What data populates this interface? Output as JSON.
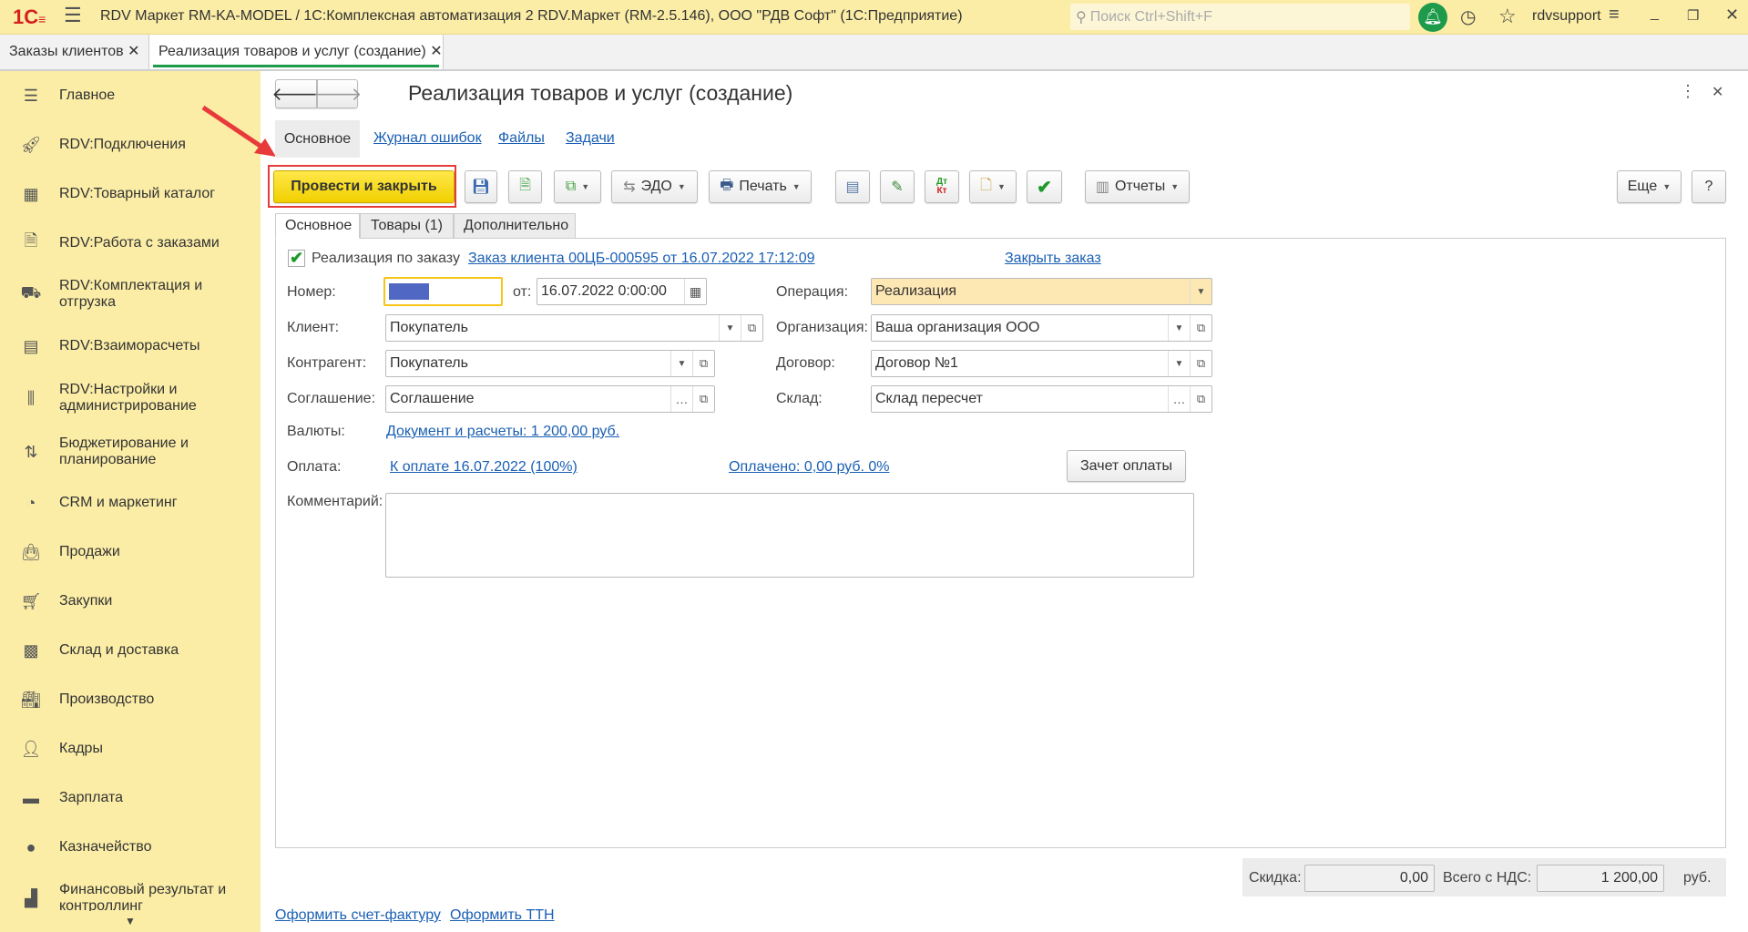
{
  "window": {
    "title": "RDV Маркет RM-KA-MODEL / 1С:Комплексная автоматизация 2 RDV.Маркет (RM-2.5.146), ООО \"РДВ Софт\"  (1С:Предприятие)",
    "search_placeholder": "Поиск Ctrl+Shift+F",
    "user": "rdvsupport",
    "logo": "1С"
  },
  "open_tabs": [
    {
      "label": "Заказы клиентов"
    },
    {
      "label": "Реализация товаров и услуг (создание)"
    }
  ],
  "sidebar": {
    "items": [
      {
        "label": "Главное",
        "icon": "menu-icon"
      },
      {
        "label": "RDV:Подключения",
        "icon": "rocket-icon"
      },
      {
        "label": "RDV:Товарный каталог",
        "icon": "grid-icon"
      },
      {
        "label": "RDV:Работа с заказами",
        "icon": "document-icon"
      },
      {
        "label": "RDV:Комплектация и отгрузка",
        "icon": "cart-loader-icon"
      },
      {
        "label": "RDV:Взаиморасчеты",
        "icon": "calculator-icon"
      },
      {
        "label": "RDV:Настройки и администрирование",
        "icon": "sliders-icon"
      },
      {
        "label": "Бюджетирование и планирование",
        "icon": "budget-icon"
      },
      {
        "label": "CRM и маркетинг",
        "icon": "pie-chart-icon"
      },
      {
        "label": "Продажи",
        "icon": "bag-icon"
      },
      {
        "label": "Закупки",
        "icon": "cart-icon"
      },
      {
        "label": "Склад и доставка",
        "icon": "warehouse-icon"
      },
      {
        "label": "Производство",
        "icon": "factory-icon"
      },
      {
        "label": "Кадры",
        "icon": "person-icon"
      },
      {
        "label": "Зарплата",
        "icon": "card-icon"
      },
      {
        "label": "Казначейство",
        "icon": "coin-icon"
      },
      {
        "label": "Финансовый результат и контроллинг",
        "icon": "bar-chart-icon"
      }
    ]
  },
  "form": {
    "title": "Реализация товаров и услуг (создание)",
    "sections": [
      "Основное",
      "Журнал ошибок",
      "Файлы",
      "Задачи"
    ],
    "toolbar": {
      "post_close": "Провести и закрыть",
      "edo": "ЭДО",
      "print": "Печать",
      "dtkt_top": "Дт",
      "dtkt_bottom": "Кт",
      "reports": "Отчеты",
      "more": "Еще",
      "help": "?"
    },
    "tabs": [
      "Основное",
      "Товары (1)",
      "Дополнительно"
    ],
    "by_order_label": "Реализация по заказу",
    "by_order_checked": true,
    "order_link": "Заказ клиента 00ЦБ-000595 от 16.07.2022 17:12:09",
    "close_order": "Закрыть заказ",
    "number_label": "Номер:",
    "date_label": "от:",
    "date": "16.07.2022  0:00:00",
    "operation_label": "Операция:",
    "operation": "Реализация",
    "client_label": "Клиент:",
    "client": "Покупатель",
    "org_label": "Организация:",
    "org": "Ваша организация ООО",
    "counterparty_label": "Контрагент:",
    "counterparty": "Покупатель",
    "contract_label": "Договор:",
    "contract": "Договор №1",
    "agreement_label": "Соглашение:",
    "agreement": "Соглашение",
    "warehouse_label": "Склад:",
    "warehouse": "Склад пересчет",
    "currency_label": "Валюты:",
    "currency_link": "Документ и расчеты: 1 200,00 руб.",
    "payment_label": "Оплата:",
    "payment_link": "К оплате 16.07.2022 (100%)",
    "paid_link": "Оплачено: 0,00 руб.  0%",
    "offset_button": "Зачет оплаты",
    "comment_label": "Комментарий:",
    "comment": "",
    "discount_label": "Скидка:",
    "discount": "0,00",
    "total_label": "Всего с НДС:",
    "total": "1 200,00",
    "currency": "руб.",
    "footer_links": [
      "Оформить счет-фактуру",
      "Оформить ТТН"
    ]
  },
  "colors": {
    "accent": "#f5d800",
    "sidebar": "#fbeda6",
    "link": "#1a5fb4",
    "highlight": "#fde7b3"
  }
}
